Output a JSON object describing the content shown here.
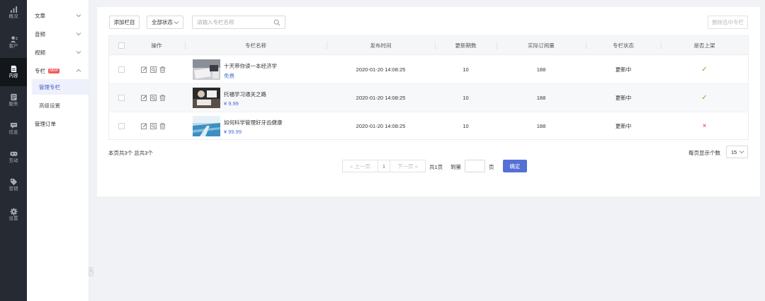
{
  "rail": [
    {
      "label": "概况",
      "icon": "chart-icon"
    },
    {
      "label": "客户",
      "icon": "customer-icon"
    },
    {
      "label": "内容",
      "icon": "content-icon",
      "active": true
    },
    {
      "label": "服务",
      "icon": "service-icon"
    },
    {
      "label": "信息",
      "icon": "message-icon"
    },
    {
      "label": "互动",
      "icon": "gamepad-icon"
    },
    {
      "label": "营销",
      "icon": "tag-icon"
    },
    {
      "label": "设置",
      "icon": "gear-icon"
    }
  ],
  "submenu": {
    "items": [
      "文章",
      "音频",
      "视频",
      "专栏"
    ],
    "new_badge": "NEW",
    "column_children": [
      "管理专栏",
      "高级设置"
    ],
    "orders": "管理订单",
    "collapse_glyph": "‹"
  },
  "toolbar": {
    "add_label": "添加栏目",
    "status_select": "全部状态",
    "search_placeholder": "请输入专栏名称",
    "delete_label": "删除选中专栏"
  },
  "table": {
    "headers": [
      "操作",
      "专栏名称",
      "发布时间",
      "更新期数",
      "实际订阅量",
      "专栏状态",
      "是否上架"
    ],
    "rows": [
      {
        "title": "十天带你读一本经济学",
        "price": "免费",
        "time": "2020-01-20 14:08:25",
        "issues": "10",
        "subs": "188",
        "status": "更新中",
        "listed": "✓",
        "listed_color": "#52c41a"
      },
      {
        "title": "托福学习通关之路",
        "price": "¥ 9.99",
        "time": "2020-01-20 14:08:25",
        "issues": "10",
        "subs": "188",
        "status": "更新中",
        "listed": "✓",
        "listed_color": "#52c41a"
      },
      {
        "title": "如何科学管理好牙齿健康",
        "price": "¥ 99.99",
        "time": "2020-01-20 14:08:25",
        "issues": "10",
        "subs": "188",
        "status": "更新中",
        "listed": "×",
        "listed_color": "#f5222d"
      }
    ]
  },
  "footer": {
    "summary": "本页共3个  总共3个",
    "prev": "« 上一页",
    "page": "1",
    "next": "下一页 »",
    "total_pages": "共1页",
    "goto": "到第",
    "page_unit": "页",
    "confirm": "确定",
    "per_page_label": "每页显示个数",
    "per_page_value": "15"
  },
  "colors": {
    "accent": "#5470d6",
    "rail_bg": "#262b33",
    "price": "#4a6cd4"
  }
}
